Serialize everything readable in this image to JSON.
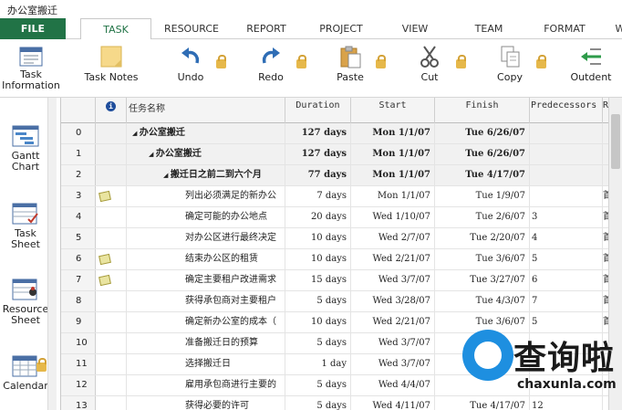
{
  "window": {
    "title": "办公室搬迁"
  },
  "ribbon": {
    "tabs": [
      {
        "label": "FILE"
      },
      {
        "label": "TASK"
      },
      {
        "label": "RESOURCE"
      },
      {
        "label": "REPORT"
      },
      {
        "label": "PROJECT"
      },
      {
        "label": "VIEW"
      },
      {
        "label": "TEAM"
      },
      {
        "label": "FORMAT"
      },
      {
        "label": "W"
      }
    ],
    "active_tab": "TASK"
  },
  "toolbar": {
    "task_information": "Task\nInformation",
    "task_notes": "Task Notes",
    "undo": "Undo",
    "redo": "Redo",
    "paste": "Paste",
    "cut": "Cut",
    "copy": "Copy",
    "outdent": "Outdent"
  },
  "sidebar": {
    "gantt": "Gantt\nChart",
    "task_sheet": "Task\nSheet",
    "resource_sheet": "Resource\nSheet",
    "calendar": "Calendar"
  },
  "grid": {
    "headers": {
      "info": "i",
      "name": "任务名称",
      "duration": "Duration",
      "start": "Start",
      "finish": "Finish",
      "predecessors": "Predecessors",
      "resources": "R"
    },
    "rows": [
      {
        "id": "0",
        "note": false,
        "name": "办公室搬迁",
        "level": 0,
        "summary": true,
        "duration": "127 days",
        "start": "Mon 1/1/07",
        "finish": "Tue 6/26/07",
        "pred": "",
        "res": ""
      },
      {
        "id": "1",
        "note": false,
        "name": "办公室搬迁",
        "level": 1,
        "summary": true,
        "duration": "127 days",
        "start": "Mon 1/1/07",
        "finish": "Tue 6/26/07",
        "pred": "",
        "res": ""
      },
      {
        "id": "2",
        "note": false,
        "name": "搬迁日之前二到六个月",
        "level": 2,
        "summary": true,
        "duration": "77 days",
        "start": "Mon 1/1/07",
        "finish": "Tue 4/17/07",
        "pred": "",
        "res": ""
      },
      {
        "id": "3",
        "note": true,
        "name": "列出必须满足的新办公",
        "level": 3,
        "summary": false,
        "duration": "7 days",
        "start": "Mon 1/1/07",
        "finish": "Tue 1/9/07",
        "pred": "",
        "res": "首"
      },
      {
        "id": "4",
        "note": false,
        "name": "确定可能的办公地点",
        "level": 3,
        "summary": false,
        "duration": "20 days",
        "start": "Wed 1/10/07",
        "finish": "Tue 2/6/07",
        "pred": "3",
        "res": "首"
      },
      {
        "id": "5",
        "note": false,
        "name": "对办公区进行最终决定",
        "level": 3,
        "summary": false,
        "duration": "10 days",
        "start": "Wed 2/7/07",
        "finish": "Tue 2/20/07",
        "pred": "4",
        "res": "首"
      },
      {
        "id": "6",
        "note": true,
        "name": "结束办公区的租赁",
        "level": 3,
        "summary": false,
        "duration": "10 days",
        "start": "Wed 2/21/07",
        "finish": "Tue 3/6/07",
        "pred": "5",
        "res": "首"
      },
      {
        "id": "7",
        "note": true,
        "name": "确定主要租户改进需求",
        "level": 3,
        "summary": false,
        "duration": "15 days",
        "start": "Wed 3/7/07",
        "finish": "Tue 3/27/07",
        "pred": "6",
        "res": "首"
      },
      {
        "id": "8",
        "note": false,
        "name": "获得承包商对主要租户",
        "level": 3,
        "summary": false,
        "duration": "5 days",
        "start": "Wed 3/28/07",
        "finish": "Tue 4/3/07",
        "pred": "7",
        "res": "首"
      },
      {
        "id": "9",
        "note": false,
        "name": "确定新办公室的成本（",
        "level": 3,
        "summary": false,
        "duration": "10 days",
        "start": "Wed 2/21/07",
        "finish": "Tue 3/6/07",
        "pred": "5",
        "res": "首"
      },
      {
        "id": "10",
        "note": false,
        "name": "准备搬迁日的预算",
        "level": 3,
        "summary": false,
        "duration": "5 days",
        "start": "Wed 3/7/07",
        "finish": "",
        "pred": "",
        "res": ""
      },
      {
        "id": "11",
        "note": false,
        "name": "选择搬迁日",
        "level": 3,
        "summary": false,
        "duration": "1 day",
        "start": "Wed 3/7/07",
        "finish": "",
        "pred": "",
        "res": ""
      },
      {
        "id": "12",
        "note": false,
        "name": "雇用承包商进行主要的",
        "level": 3,
        "summary": false,
        "duration": "5 days",
        "start": "Wed 4/4/07",
        "finish": "",
        "pred": "",
        "res": ""
      },
      {
        "id": "13",
        "note": false,
        "name": "获得必要的许可",
        "level": 3,
        "summary": false,
        "duration": "5 days",
        "start": "Wed 4/11/07",
        "finish": "Tue 4/17/07",
        "pred": "12",
        "res": ""
      }
    ]
  },
  "watermark": {
    "text": "查询啦",
    "sub": "chaxunla.com"
  },
  "colors": {
    "file_tab": "#217346",
    "accent": "#217346",
    "watermark_blue": "#1e8fe0"
  }
}
